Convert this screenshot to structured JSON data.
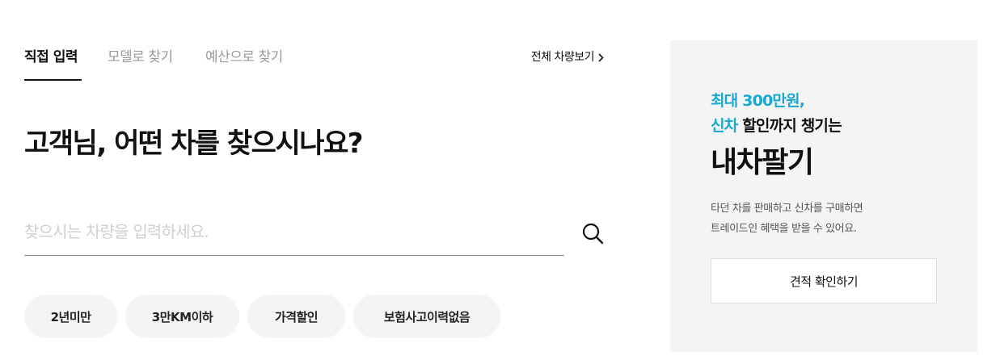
{
  "tabs": [
    {
      "label": "직접 입력",
      "active": true
    },
    {
      "label": "모델로 찾기",
      "active": false
    },
    {
      "label": "예산으로 찾기",
      "active": false
    }
  ],
  "view_all": {
    "label": "전체 차량보기",
    "icon": "chevron-right-icon"
  },
  "headline": "고객님, 어떤 차를 찾으시나요?",
  "search": {
    "value": "",
    "placeholder": "찾으시는 차량을 입력하세요.",
    "icon": "search-icon"
  },
  "chips": [
    "2년미만",
    "3만KM이하",
    "가격할인",
    "보험사고이력없음"
  ],
  "promo": {
    "line1": "최대 300만원,",
    "line2_accent": "신차",
    "line2_rest": " 할인까지 챙기는",
    "title": "내차팔기",
    "desc_line1": "타던 차를 판매하고 신차를 구매하면",
    "desc_line2": "트레이드인 혜택을 받을 수 있어요.",
    "button_label": "견적 확인하기"
  },
  "colors": {
    "accent": "#1aa8d3",
    "panel_bg": "#f4f4f4",
    "chip_bg": "#f4f4f4",
    "text": "#111111"
  }
}
